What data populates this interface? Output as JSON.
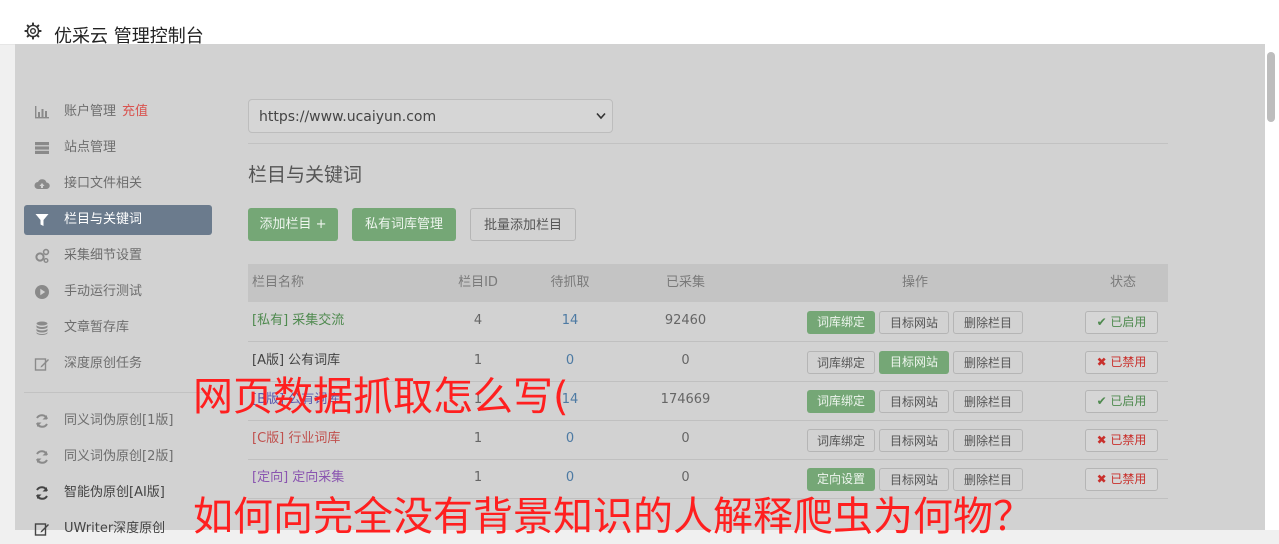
{
  "header": {
    "title": "优采云 管理控制台"
  },
  "sidebar": {
    "items": [
      {
        "label": "账户管理",
        "badge": "充值",
        "icon": "bar-chart-icon"
      },
      {
        "label": "站点管理",
        "icon": "server-icon"
      },
      {
        "label": "接口文件相关",
        "icon": "cloud-upload-icon"
      },
      {
        "label": "栏目与关键词",
        "icon": "filter-icon",
        "active": true
      },
      {
        "label": "采集细节设置",
        "icon": "gears-icon"
      },
      {
        "label": "手动运行测试",
        "icon": "play-circle-icon"
      },
      {
        "label": "文章暂存库",
        "icon": "database-icon"
      },
      {
        "label": "深度原创任务",
        "icon": "edit-icon"
      },
      {
        "label": "同义词伪原创[1版]",
        "icon": "refresh-icon"
      },
      {
        "label": "同义词伪原创[2版]",
        "icon": "refresh-icon"
      },
      {
        "label": "智能伪原创[AI版]",
        "icon": "refresh-icon"
      },
      {
        "label": "UWriter深度原创",
        "icon": "edit-icon"
      }
    ]
  },
  "main": {
    "site_select": "https://www.ucaiyun.com",
    "heading": "栏目与关键词",
    "buttons": {
      "add_column": "添加栏目 +",
      "private_lib": "私有词库管理",
      "batch_add": "批量添加栏目"
    },
    "table": {
      "headers": [
        "栏目名称",
        "栏目ID",
        "待抓取",
        "已采集",
        "操作",
        "状态"
      ],
      "ops": {
        "bind": "词库绑定",
        "target": "目标网站",
        "delete": "删除栏目",
        "direct": "定向设置"
      },
      "rows": [
        {
          "name": "[私有] 采集交流",
          "id": "4",
          "pending": "14",
          "collected": "92460",
          "status": "✔ 已启用"
        },
        {
          "name": "[A版] 公有词库",
          "id": "1",
          "pending": "0",
          "collected": "0",
          "status": "✖ 已禁用"
        },
        {
          "name": "[B版] 公有词库",
          "id": "1",
          "pending": "14",
          "collected": "174669",
          "status": "✔ 已启用"
        },
        {
          "name": "[C版] 行业词库",
          "id": "1",
          "pending": "0",
          "collected": "0",
          "status": "✖ 已禁用"
        },
        {
          "name": "[定向] 定向采集",
          "id": "1",
          "pending": "0",
          "collected": "0",
          "status": "✖ 已禁用"
        }
      ]
    }
  },
  "overlay": {
    "line1": "网页数据抓取怎么写(",
    "line2": "如何向完全没有背景知识的人解释爬虫为何物？"
  },
  "colors": {
    "overlay_text": "#ff1f1f",
    "active_nav": "#6b7b8d",
    "green_button": "#75a776"
  }
}
